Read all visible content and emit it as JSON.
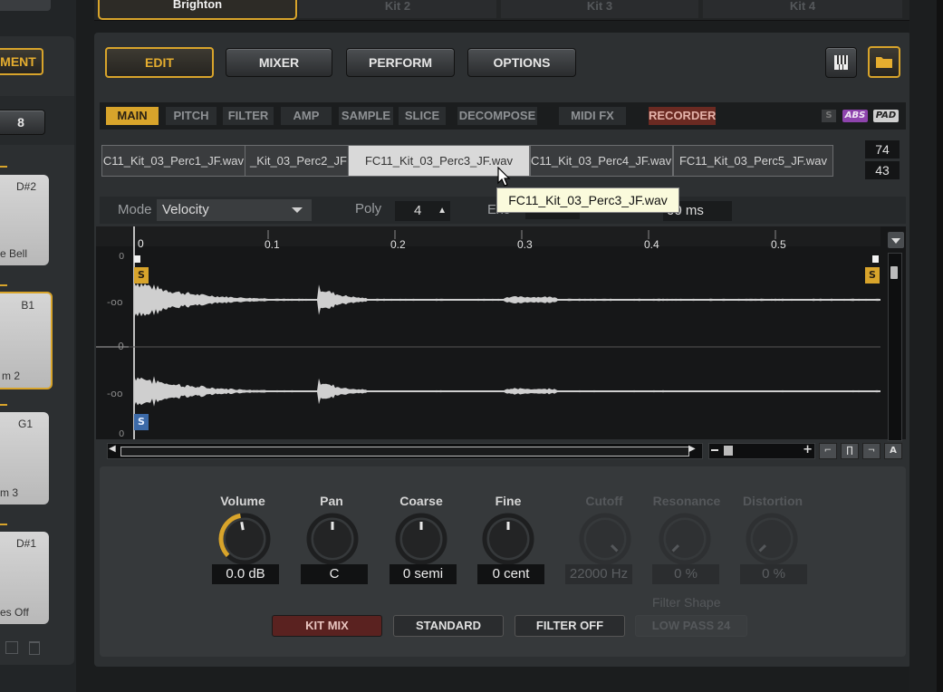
{
  "kit_tabs": [
    {
      "label": "Brighton",
      "active": true
    },
    {
      "label": "Kit 2",
      "active": false
    },
    {
      "label": "Kit 3",
      "active": false
    },
    {
      "label": "Kit 4",
      "active": false
    }
  ],
  "left": {
    "instrument_button": "MENT",
    "number_value": "8",
    "pads": [
      {
        "note": "D#2",
        "name": "e Bell",
        "selected": false
      },
      {
        "note": "B1",
        "name": "m 2",
        "selected": true
      },
      {
        "note": "G1",
        "name": "m 3",
        "selected": false
      },
      {
        "note": "D#1",
        "name": "es Off",
        "selected": false
      }
    ]
  },
  "toolbar": {
    "edit": "EDIT",
    "mixer": "MIXER",
    "perform": "PERFORM",
    "options": "OPTIONS"
  },
  "subtabs": {
    "main": "MAIN",
    "pitch": "PITCH",
    "filter": "FILTER",
    "amp": "AMP",
    "sample": "SAMPLE",
    "slice": "SLICE",
    "decompose": "DECOMPOSE",
    "midi_fx": "MIDI FX",
    "recorder": "RECORDER",
    "s": "S",
    "abs": "ABS",
    "pad": "PAD"
  },
  "slots": [
    "C11_Kit_03_Perc1_JF.wav",
    "_Kit_03_Perc2_JF",
    "FC11_Kit_03_Perc3_JF.wav",
    "C11_Kit_03_Perc4_JF.wav",
    "FC11_Kit_03_Perc5_JF.wav"
  ],
  "velocity": {
    "high": "74",
    "low": "43"
  },
  "tooltip": "FC11_Kit_03_Perc3_JF.wav",
  "params": {
    "mode_label": "Mode",
    "mode_value": "Velocity",
    "poly_label": "Poly",
    "poly_value": "4",
    "exc_label": "Exc",
    "time_value": "00 ms"
  },
  "waveform": {
    "db_label": "dB",
    "ruler": [
      "0",
      "0.1",
      "0.2",
      "0.3",
      "0.4",
      "0.5"
    ],
    "db_ticks": [
      "0",
      "-oo",
      "0",
      "-oo",
      "0"
    ],
    "start_marker": "S",
    "end_marker": "S",
    "zoom_a": "A"
  },
  "controls": {
    "volume": {
      "label": "Volume",
      "value": "0.0 dB"
    },
    "pan": {
      "label": "Pan",
      "value": "C"
    },
    "coarse": {
      "label": "Coarse",
      "value": "0 semi"
    },
    "fine": {
      "label": "Fine",
      "value": "0 cent"
    },
    "cutoff": {
      "label": "Cutoff",
      "value": "22000 Hz"
    },
    "resonance": {
      "label": "Resonance",
      "value": "0 %"
    },
    "distortion": {
      "label": "Distortion",
      "value": "0 %"
    },
    "filter_shape_label": "Filter Shape"
  },
  "bottom_buttons": {
    "kit_mix": "KIT MIX",
    "standard": "STANDARD",
    "filter_off": "FILTER OFF",
    "low_pass": "LOW PASS 24"
  },
  "colors": {
    "accent": "#d8a42b",
    "recorder": "#c0392b",
    "abs": "#8e44ad"
  }
}
